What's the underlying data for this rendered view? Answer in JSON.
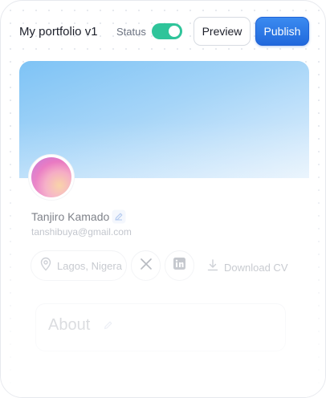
{
  "header": {
    "title": "My portfolio v1",
    "status_label": "Status",
    "status_on": true,
    "preview_label": "Preview",
    "publish_label": "Publish"
  },
  "profile": {
    "name": "Tanjiro Kamado",
    "email": "tanshibuya@gmail.com",
    "location": "Lagos, Nigera",
    "download_label": "Download CV",
    "about_title": "About"
  },
  "icons": {
    "edit": "pencil-icon",
    "location": "map-pin-icon",
    "x": "x-logo-icon",
    "linkedin": "linkedin-icon",
    "download": "download-icon"
  },
  "colors": {
    "toggle_on": "#2fc49a",
    "publish": "#2068dc",
    "banner_top": "#7ec3f5",
    "banner_bottom": "#e6f2fd"
  }
}
